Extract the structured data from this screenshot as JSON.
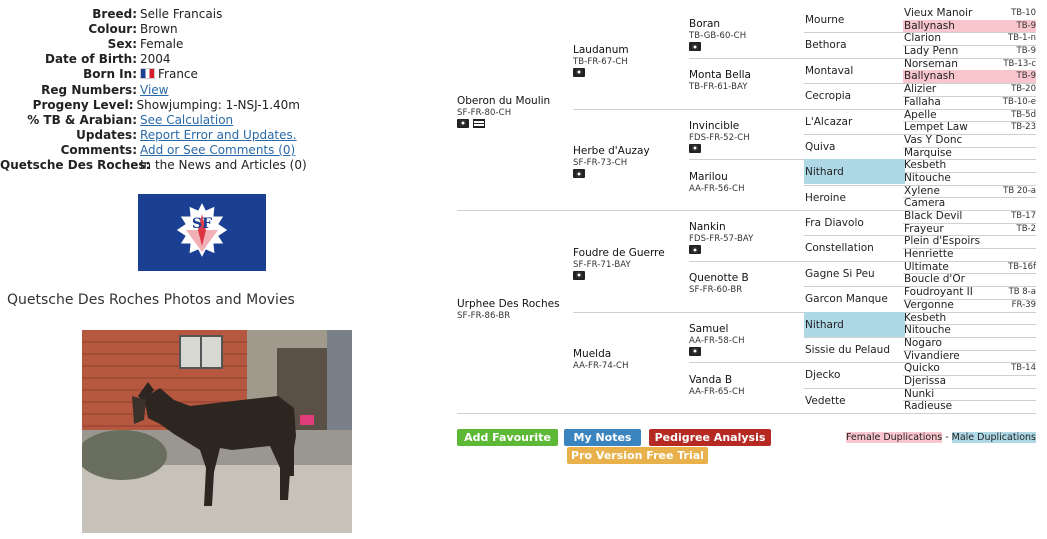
{
  "info": {
    "breed_label": "Breed:",
    "breed": "Selle Francais",
    "colour_label": "Colour:",
    "colour": "Brown",
    "sex_label": "Sex:",
    "sex": "Female",
    "dob_label": "Date of Birth:",
    "dob": "2004",
    "born_label": "Born In:",
    "born": "France",
    "reg_label": "Reg Numbers:",
    "reg_link": "View",
    "progeny_label": "Progeny Level:",
    "progeny": "Showjumping: 1-NSJ-1.40m",
    "tb_label": "% TB & Arabian:",
    "tb_link": "See Calculation",
    "updates_label": "Updates:",
    "updates_link": "Report Error and Updates.",
    "comments_label": "Comments:",
    "comments_link": "Add or See Comments (0)",
    "news_label": "Quetsche Des Roches:",
    "news": "In the News and Articles (0)"
  },
  "logo_text": "SF",
  "gallery_title": "Quetsche Des Roches Photos and Movies",
  "pedigree": {
    "gen1": [
      {
        "name": "Oberon du Moulin",
        "reg": "SF-FR-80-CH"
      },
      {
        "name": "Urphee Des Roches",
        "reg": "SF-FR-86-BR"
      }
    ],
    "gen2": [
      {
        "name": "Laudanum",
        "reg": "TB-FR-67-CH"
      },
      {
        "name": "Herbe d'Auzay",
        "reg": "SF-FR-73-CH"
      },
      {
        "name": "Foudre de Guerre",
        "reg": "SF-FR-71-BAY"
      },
      {
        "name": "Muelda",
        "reg": "AA-FR-74-CH"
      }
    ],
    "gen3": [
      {
        "name": "Boran",
        "reg": "TB-GB-60-CH"
      },
      {
        "name": "Monta Bella",
        "reg": "TB-FR-61-BAY"
      },
      {
        "name": "Invincible",
        "reg": "FDS-FR-52-CH"
      },
      {
        "name": "Marilou",
        "reg": "AA-FR-56-CH"
      },
      {
        "name": "Nankin",
        "reg": "FDS-FR-57-BAY"
      },
      {
        "name": "Quenotte B",
        "reg": "SF-FR-60-BR"
      },
      {
        "name": "Samuel",
        "reg": "AA-FR-58-CH"
      },
      {
        "name": "Vanda B",
        "reg": "AA-FR-65-CH"
      }
    ],
    "gen4": [
      {
        "name": "Mourne",
        "dup": ""
      },
      {
        "name": "Bethora",
        "dup": ""
      },
      {
        "name": "Montaval",
        "dup": ""
      },
      {
        "name": "Cecropia",
        "dup": ""
      },
      {
        "name": "L'Alcazar",
        "dup": ""
      },
      {
        "name": "Quiva",
        "dup": ""
      },
      {
        "name": "Nithard",
        "dup": "male"
      },
      {
        "name": "Heroine",
        "dup": ""
      },
      {
        "name": "Fra Diavolo",
        "dup": ""
      },
      {
        "name": "Constellation",
        "dup": ""
      },
      {
        "name": "Gagne Si Peu",
        "dup": ""
      },
      {
        "name": "Garcon Manque",
        "dup": ""
      },
      {
        "name": "Nithard",
        "dup": "male"
      },
      {
        "name": "Sissie du Pelaud",
        "dup": ""
      },
      {
        "name": "Djecko",
        "dup": ""
      },
      {
        "name": "Vedette",
        "dup": ""
      }
    ],
    "gen5": [
      {
        "name": "Vieux Manoir",
        "cls": "TB-10",
        "dup": ""
      },
      {
        "name": "Ballynash",
        "cls": "TB-9",
        "dup": "female"
      },
      {
        "name": "Clarion",
        "cls": "TB-1-n",
        "dup": ""
      },
      {
        "name": "Lady Penn",
        "cls": "TB-9",
        "dup": ""
      },
      {
        "name": "Norseman",
        "cls": "TB-13-c",
        "dup": ""
      },
      {
        "name": "Ballynash",
        "cls": "TB-9",
        "dup": "female"
      },
      {
        "name": "Alizier",
        "cls": "TB-20",
        "dup": ""
      },
      {
        "name": "Fallaha",
        "cls": "TB-10-e",
        "dup": ""
      },
      {
        "name": "Apelle",
        "cls": "TB-5d",
        "dup": ""
      },
      {
        "name": "Lempet Law",
        "cls": "TB-23",
        "dup": ""
      },
      {
        "name": "Vas Y Donc",
        "cls": "",
        "dup": ""
      },
      {
        "name": "Marquise",
        "cls": "",
        "dup": ""
      },
      {
        "name": "Kesbeth",
        "cls": "",
        "dup": ""
      },
      {
        "name": "Nitouche",
        "cls": "",
        "dup": ""
      },
      {
        "name": "Xylene",
        "cls": "TB 20-a",
        "dup": ""
      },
      {
        "name": "Camera",
        "cls": "",
        "dup": ""
      },
      {
        "name": "Black Devil",
        "cls": "TB-17",
        "dup": ""
      },
      {
        "name": "Frayeur",
        "cls": "TB-2",
        "dup": ""
      },
      {
        "name": "Plein d'Espoirs",
        "cls": "",
        "dup": ""
      },
      {
        "name": "Henriette",
        "cls": "",
        "dup": ""
      },
      {
        "name": "Ultimate",
        "cls": "TB-16f",
        "dup": ""
      },
      {
        "name": "Boucle d'Or",
        "cls": "",
        "dup": ""
      },
      {
        "name": "Foudroyant II",
        "cls": "TB 8-a",
        "dup": ""
      },
      {
        "name": "Vergonne",
        "cls": "FR-39",
        "dup": ""
      },
      {
        "name": "Kesbeth",
        "cls": "",
        "dup": ""
      },
      {
        "name": "Nitouche",
        "cls": "",
        "dup": ""
      },
      {
        "name": "Nogaro",
        "cls": "",
        "dup": ""
      },
      {
        "name": "Vivandiere",
        "cls": "",
        "dup": ""
      },
      {
        "name": "Quicko",
        "cls": "TB-14",
        "dup": ""
      },
      {
        "name": "Djerissa",
        "cls": "",
        "dup": ""
      },
      {
        "name": "Nunki",
        "cls": "",
        "dup": ""
      },
      {
        "name": "Radieuse",
        "cls": "",
        "dup": ""
      }
    ]
  },
  "buttons": {
    "add_favourite": "Add Favourite",
    "my_notes": "My Notes",
    "pedigree_analysis": "Pedigree Analysis",
    "pro_trial": "Pro Version Free Trial"
  },
  "legend": {
    "female": "Female Duplications",
    "sep": " - ",
    "male": "Male Duplications"
  },
  "colors": {
    "green": "#5cb835",
    "blue": "#3a84c0",
    "red": "#b52a22",
    "orange": "#e8b14c",
    "female_dup": "#f8c6cc",
    "male_dup": "#aed8e6"
  }
}
